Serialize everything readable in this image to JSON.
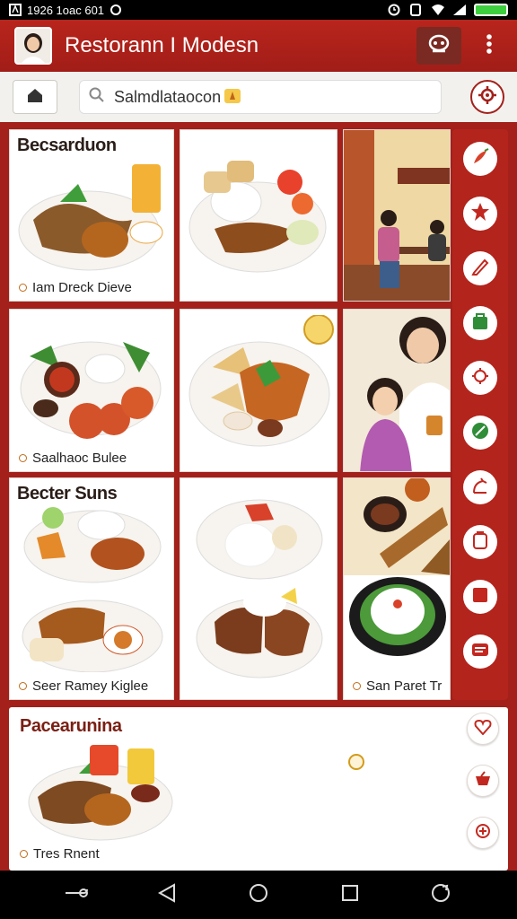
{
  "status_bar": {
    "left_text": "1926 1oac 601"
  },
  "app": {
    "title": "Restorann I Modesn"
  },
  "search": {
    "query": "Salmdlataocon"
  },
  "cards": [
    {
      "title": "Becsarduon",
      "caption": "Iam Dreck Dieve"
    },
    {
      "title": "",
      "caption": ""
    },
    {
      "title": "",
      "caption": ""
    },
    {
      "title": "",
      "caption": "Saalhaoc Bulee"
    },
    {
      "title": "",
      "caption": ""
    },
    {
      "title": "",
      "caption": ""
    },
    {
      "title": "Becter Suns",
      "caption": "Seer Ramey Kiglee"
    },
    {
      "title": "",
      "caption": ""
    },
    {
      "title": "",
      "caption": "San Paret Tr"
    }
  ],
  "bottom_card": {
    "title": "Pacearunina",
    "caption": "Tres Rnent"
  },
  "sidebar_icons": [
    "chili-icon",
    "star-icon",
    "pen-icon",
    "shopping-bag-icon",
    "gear-icon",
    "leaf-icon",
    "upload-icon",
    "copy-icon",
    "square-icon",
    "menu-icon"
  ],
  "colors": {
    "primary": "#a3201b",
    "accent": "#d39b1a",
    "surface": "#ffffff"
  }
}
